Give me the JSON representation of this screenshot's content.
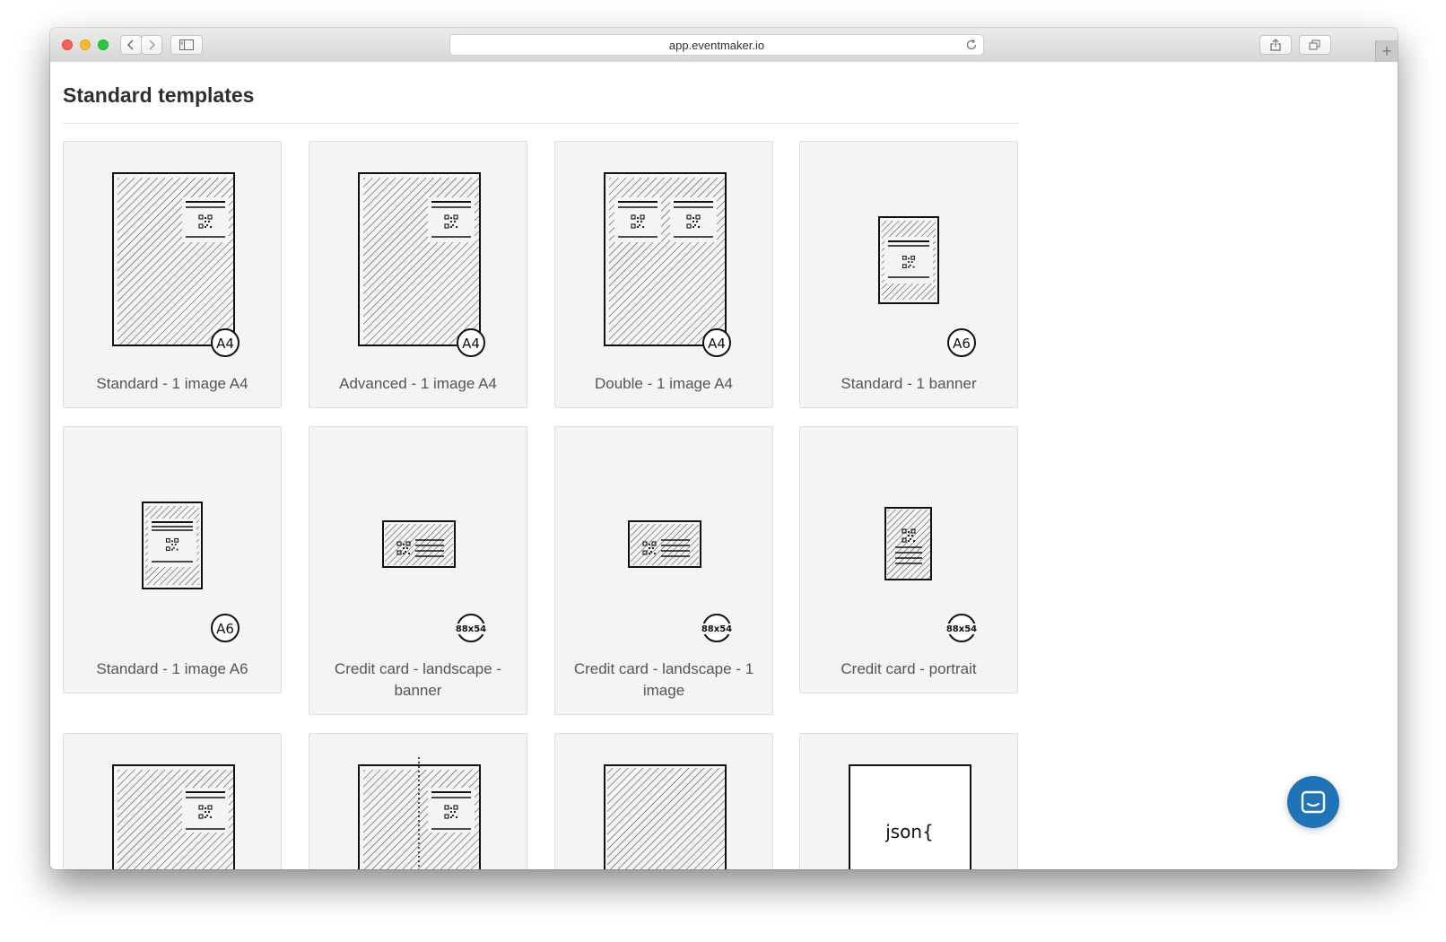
{
  "browser": {
    "url": "app.eventmaker.io",
    "icons": {
      "back": "chevron-left-icon",
      "forward": "chevron-right-icon",
      "sidebar": "sidebar-icon",
      "reload": "reload-icon",
      "share": "share-icon",
      "tabs": "tabs-icon",
      "new_tab": "plus-icon"
    }
  },
  "page": {
    "title": "Standard templates"
  },
  "templates": [
    {
      "label": "Standard - 1 image A4",
      "badge": "A4"
    },
    {
      "label": "Advanced - 1 image A4",
      "badge": "A4"
    },
    {
      "label": "Double - 1 image A4",
      "badge": "A4"
    },
    {
      "label": "Standard - 1 banner",
      "badge": "A6"
    },
    {
      "label": "Standard - 1 image A6",
      "badge": "A6"
    },
    {
      "label": "Credit card - landscape - banner",
      "badge": "88x54"
    },
    {
      "label": "Credit card - landscape - 1 image",
      "badge": "88x54"
    },
    {
      "label": "Credit card - portrait",
      "badge": "88x54"
    },
    {
      "label": "",
      "badge": ""
    },
    {
      "label": "",
      "badge": ""
    },
    {
      "label": "",
      "badge": ""
    },
    {
      "label": "",
      "badge": "",
      "preview_text": "json{"
    }
  ],
  "chat_widget": {
    "icon": "chat-bubble-icon",
    "color": "#1f73b7"
  }
}
